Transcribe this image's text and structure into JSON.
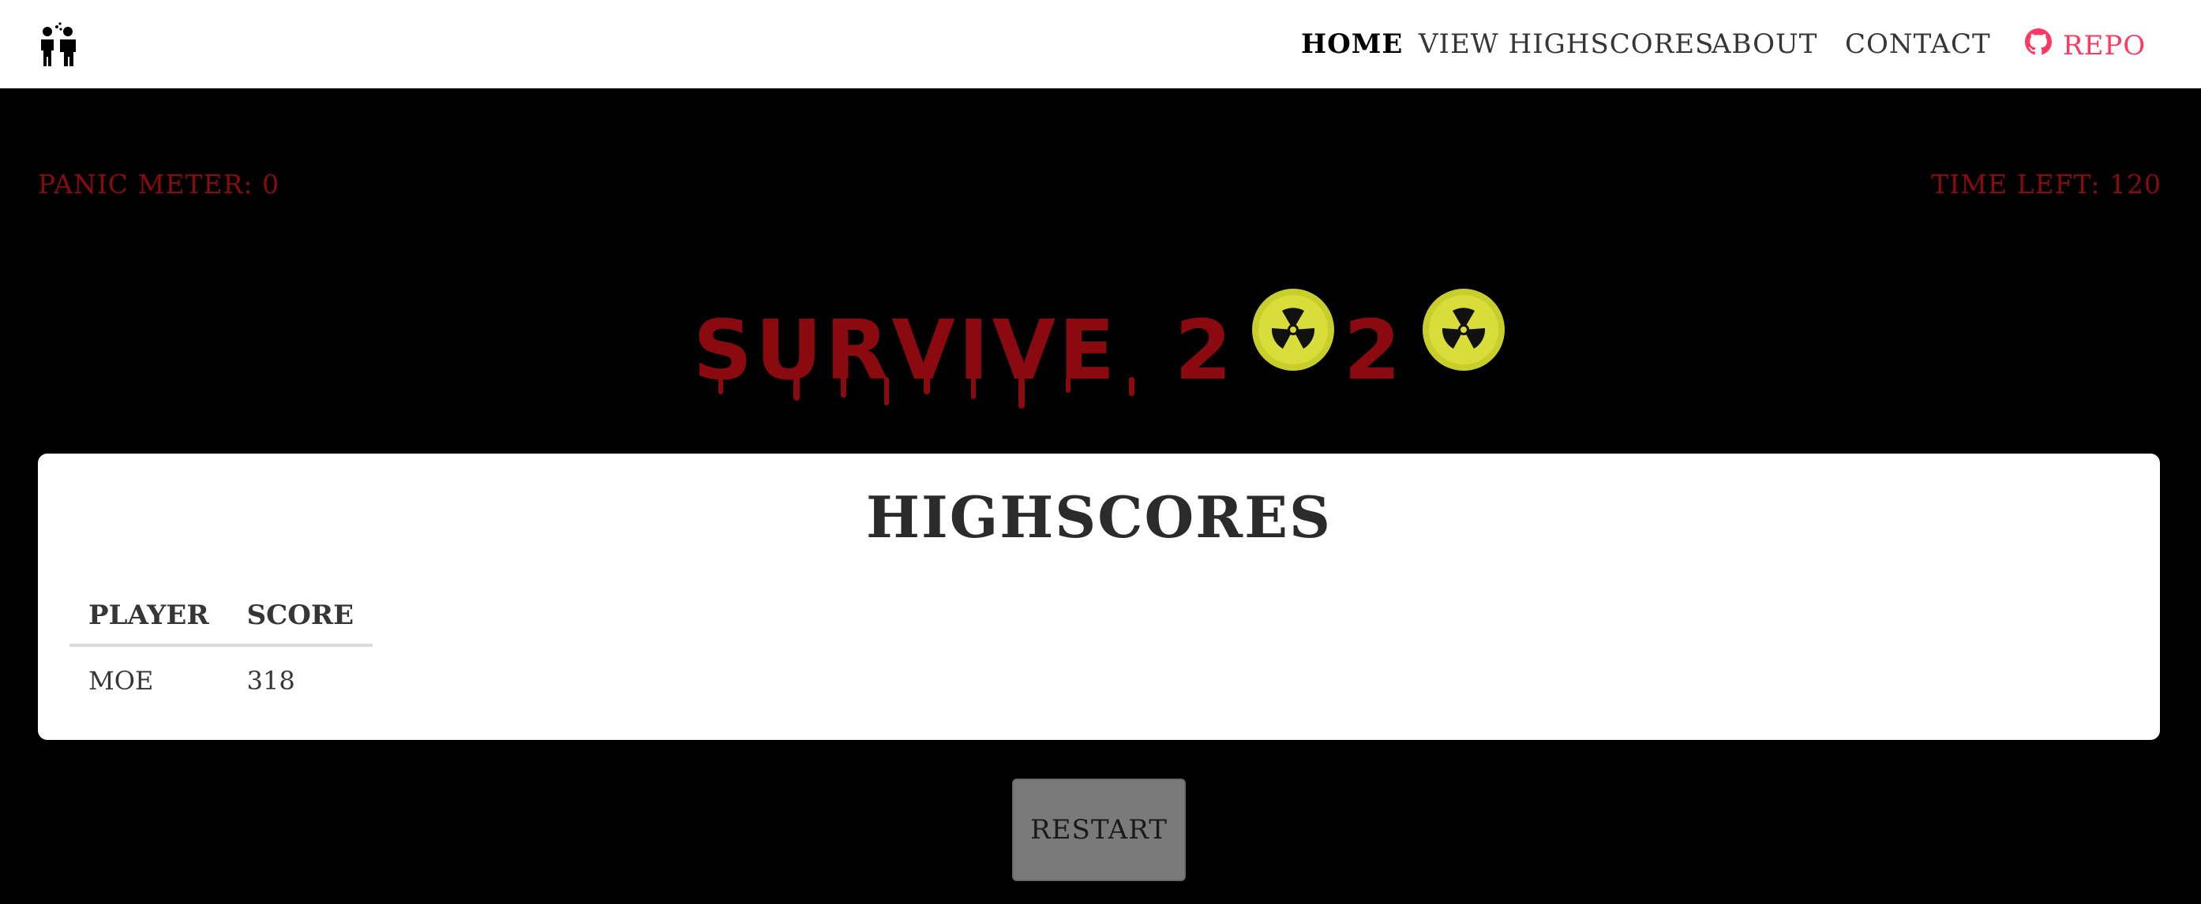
{
  "nav": {
    "brand_icon": "person-sneezing-icon",
    "home": "HOME",
    "view_highscores": "VIEW HIGHSCORES",
    "about": "ABOUT",
    "contact": "CONTACT",
    "repo": "REPO",
    "repo_icon": "github-icon"
  },
  "status": {
    "panic_meter": "PANIC METER: 0",
    "time_left": "TIME LEFT: 120"
  },
  "logo": {
    "text_survive": "SURVIVE",
    "text_2a": "2",
    "text_2b": "2",
    "icon": "radiation-hazard-icon"
  },
  "highscores": {
    "title": "HIGHSCORES",
    "columns": [
      "PLAYER",
      "SCORE"
    ],
    "rows": [
      {
        "player": "MOE",
        "score": "318"
      }
    ]
  },
  "restart_label": "RESTART",
  "colors": {
    "blood_red": "#8b0a0f",
    "radiation_yellow": "#c9cf2a",
    "repo_pink": "#ff3860"
  }
}
